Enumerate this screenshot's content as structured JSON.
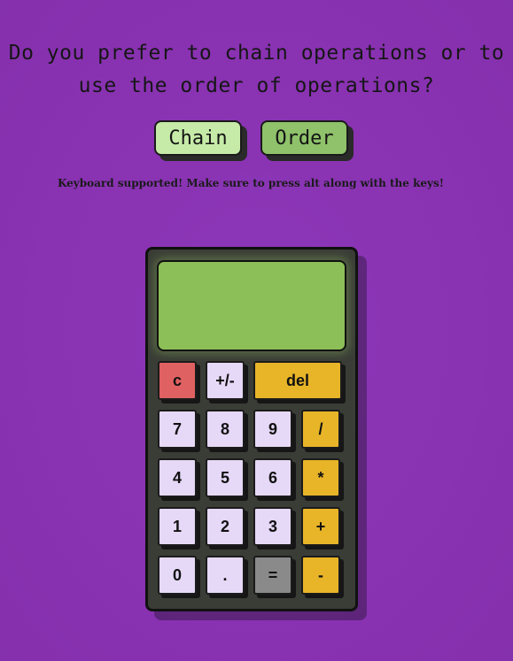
{
  "question": {
    "line1": "Do you prefer to chain operations or to",
    "line2": "use the order of operations?"
  },
  "modes": {
    "chain_label": "Chain",
    "order_label": "Order"
  },
  "hint": "Keyboard supported! Make sure to press alt along with the keys!",
  "display": {
    "value": ""
  },
  "keys": {
    "clear": "c",
    "sign": "+/-",
    "delete": "del",
    "seven": "7",
    "eight": "8",
    "nine": "9",
    "divide": "/",
    "four": "4",
    "five": "5",
    "six": "6",
    "multiply": "*",
    "one": "1",
    "two": "2",
    "three": "3",
    "add": "+",
    "zero": "0",
    "decimal": ".",
    "equals": "=",
    "subtract": "-"
  },
  "colors": {
    "background": "#8a34b4",
    "display": "#8cbf57",
    "number_key": "#e6d8f7",
    "operator_key": "#e8b528",
    "clear_key": "#e06161",
    "equals_key": "#8a8a8a",
    "chain_button": "#c6eba8",
    "order_button": "#8fc26a"
  }
}
